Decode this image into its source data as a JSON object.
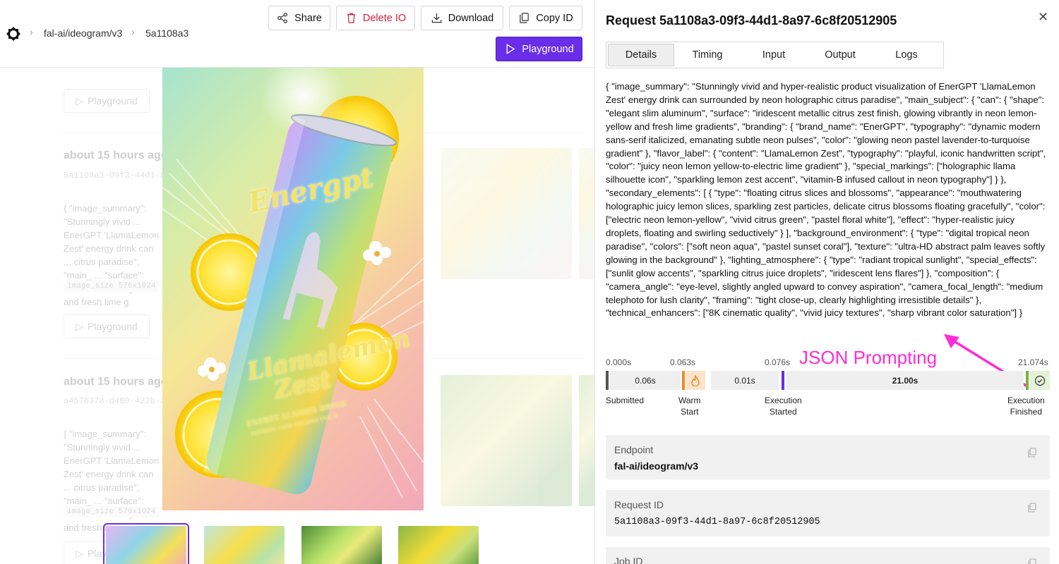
{
  "breadcrumb": {
    "model": "fal-ai/ideogram/v3",
    "request_short": "5a1108a3"
  },
  "toolbar": {
    "share": "Share",
    "delete": "Delete IO",
    "download": "Download",
    "copy_id": "Copy ID",
    "playground": "Playground"
  },
  "list": {
    "playground_label": "Playground",
    "items": [
      {
        "time": "about 15 hours ago",
        "id": "5a1108a3-09f3-44d1-8",
        "text": "{ \"image_summary\": \"Stunningly vivid ... EnerGPT 'LlamaLemon Zest' energy drink can ... citrus paradise\", \"main_ ... \"surface\": \"iridescent m ... yellow and fresh lime g",
        "tag": "image_size 576x1024"
      },
      {
        "time": "about 15 hours ago",
        "id": "a4576378-d480-422b-a",
        "text": "{ \"image_summary\": \"Stunningly vivid ... EnerGPT 'LlamaLemon Zest' energy drink can ... citrus paradise\", \"main_ ... \"surface\": \"iridescent m ... yellow and fresh lime g",
        "tag": "image_size 576x1024"
      }
    ]
  },
  "hero": {
    "brand": "Energpt",
    "flavor_line1": "Llamalemon",
    "flavor_line2": "Zest",
    "tag1": "ENERPT LLAMON BRINK",
    "tag2": "TEXMON CAES TELAMO VNE R"
  },
  "panel": {
    "title": "Request 5a1108a3-09f3-44d1-8a97-6c8f20512905",
    "tabs": [
      "Details",
      "Timing",
      "Input",
      "Output",
      "Logs"
    ],
    "active_tab": "Details",
    "json_text": "{ \"image_summary\": \"Stunningly vivid and hyper-realistic product visualization of EnerGPT 'LlamaLemon Zest' energy drink can surrounded by neon holographic citrus paradise\", \"main_subject\": { \"can\": { \"shape\": \"elegant slim aluminum\", \"surface\": \"iridescent metallic citrus zest finish, glowing vibrantly in neon lemon-yellow and fresh lime gradients\", \"branding\": { \"brand_name\": \"EnerGPT\", \"typography\": \"dynamic modern sans-serif italicized, emanating subtle neon pulses\", \"color\": \"glowing neon pastel lavender-to-turquoise gradient\" }, \"flavor_label\": { \"content\": \"LlamaLemon Zest\", \"typography\": \"playful, iconic handwritten script\", \"color\": \"juicy neon lemon yellow-to-electric lime gradient\" }, \"special_markings\": [\"holographic llama silhouette icon\", \"sparkling lemon zest accent\", \"vitamin-B infused callout in neon typography\"] } }, \"secondary_elements\": [ { \"type\": \"floating citrus slices and blossoms\", \"appearance\": \"mouthwatering holographic juicy lemon slices, sparkling zest particles, delicate citrus blossoms floating gracefully\", \"color\": [\"electric neon lemon-yellow\", \"vivid citrus green\", \"pastel floral white\"], \"effect\": \"hyper-realistic juicy droplets, floating and swirling seductively\" } ], \"background_environment\": { \"type\": \"digital tropical neon paradise\", \"colors\": [\"soft neon aqua\", \"pastel sunset coral\"], \"texture\": \"ultra-HD abstract palm leaves softly glowing in the background\" }, \"lighting_atmosphere\": { \"type\": \"radiant tropical sunlight\", \"special_effects\": [\"sunlit glow accents\", \"sparkling citrus juice droplets\", \"iridescent lens flares\"] }, \"composition\": { \"camera_angle\": \"eye-level, slightly angled upward to convey aspiration\", \"camera_focal_length\": \"medium telephoto for lush clarity\", \"framing\": \"tight close-up, clearly highlighting irresistible details\" }, \"technical_enhancers\": [\"8K cinematic quality\", \"vivid juicy textures\", \"sharp vibrant color saturation\"] }",
    "annotation": "JSON Prompting",
    "timeline": {
      "ticks": [
        "0.000s",
        "0.063s",
        "0.076s",
        "21.074s"
      ],
      "segments": [
        "0.06s",
        "0.01s",
        "21.00s"
      ],
      "captions": {
        "submitted": "Submitted",
        "warm1": "Warm",
        "warm2": "Start",
        "exec1": "Execution",
        "exec2": "Started",
        "fin1": "Execution",
        "fin2": "Finished"
      },
      "colors": {
        "submitted": "#555555",
        "warm": "#f08a24",
        "exec": "#6a2ee8",
        "finished": "#7bb33a"
      }
    },
    "endpoint_label": "Endpoint",
    "endpoint_value": "fal-ai/ideogram/v3",
    "request_id_label": "Request ID",
    "request_id_value": "5a1108a3-09f3-44d1-8a97-6c8f20512905",
    "job_id_label": "Job ID"
  }
}
